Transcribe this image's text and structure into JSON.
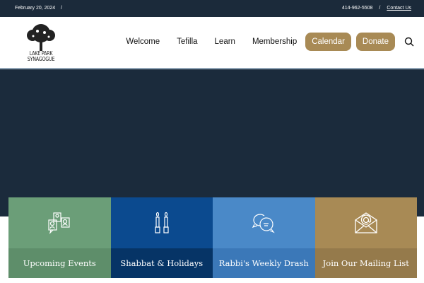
{
  "topbar": {
    "date": "February 20, 2024",
    "separator": "/",
    "phone": "414-962-5508",
    "contact": "Contact Us"
  },
  "logo": {
    "line1": "LAKE PARK",
    "line2": "SYNAGOGUE"
  },
  "nav": {
    "items": [
      "Welcome",
      "Tefilla",
      "Learn",
      "Membership"
    ],
    "buttons": [
      "Calendar",
      "Donate"
    ],
    "search_icon": "search-icon"
  },
  "cards": [
    {
      "label": "Upcoming Events",
      "icon": "people-icon",
      "color": "#6b9e78",
      "footer_color": "#5e8e6a"
    },
    {
      "label": "Shabbat & Holidays",
      "icon": "candles-icon",
      "color": "#0b4a8f",
      "footer_color": "#063466"
    },
    {
      "label": "Rabbi's Weekly Drash",
      "icon": "chat-bubbles-icon",
      "color": "#4a89c8",
      "footer_color": "#3b78b8"
    },
    {
      "label": "Join Our Mailing List",
      "icon": "envelope-icon",
      "color": "#a88a55",
      "footer_color": "#957a4b"
    }
  ]
}
